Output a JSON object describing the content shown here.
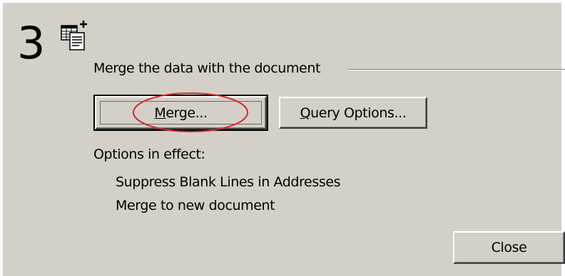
{
  "step": {
    "number": "3",
    "icon": "merge-document-icon"
  },
  "group": {
    "label": "Merge the data with the document"
  },
  "buttons": {
    "merge": {
      "mnemonic": "M",
      "rest": "erge..."
    },
    "query_options": {
      "mnemonic": "Q",
      "rest": "uery Options..."
    },
    "close": {
      "label": "Close"
    }
  },
  "options": {
    "title": "Options in effect:",
    "items": [
      "Suppress Blank Lines in Addresses",
      "Merge to new document"
    ]
  },
  "colors": {
    "background": "#d4d0c8",
    "highlight_oval": "#d42a2a"
  }
}
